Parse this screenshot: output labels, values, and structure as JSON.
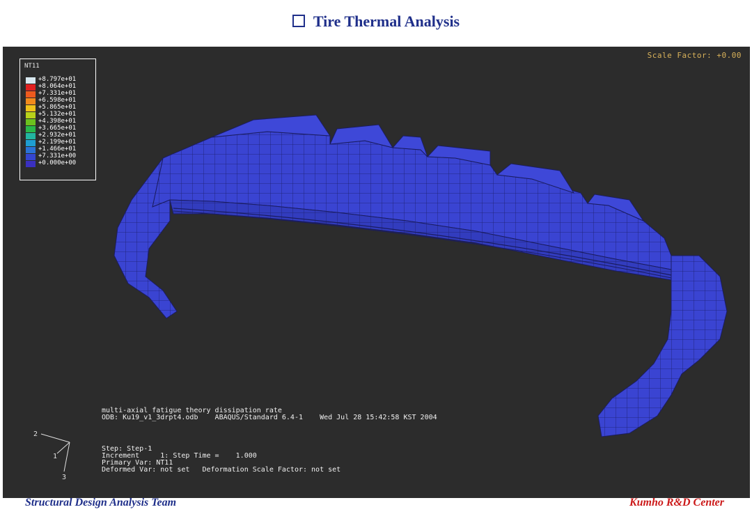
{
  "slide": {
    "title": "Tire Thermal Analysis",
    "footer_left": "Structural Design Analysis Team",
    "footer_right": "Kumho R&D Center"
  },
  "viewport": {
    "scale_factor": "Scale Factor: +0.00",
    "legend": {
      "variable": "NT11",
      "entries": [
        {
          "label": "+8.797e+01",
          "color": "#d8e8f0"
        },
        {
          "label": "+8.064e+01",
          "color": "#e02020"
        },
        {
          "label": "+7.331e+01",
          "color": "#ee5a1e"
        },
        {
          "label": "+6.598e+01",
          "color": "#f28a1c"
        },
        {
          "label": "+5.865e+01",
          "color": "#f0c21a"
        },
        {
          "label": "+5.132e+01",
          "color": "#b8d21a"
        },
        {
          "label": "+4.398e+01",
          "color": "#6cc21e"
        },
        {
          "label": "+3.665e+01",
          "color": "#2ab84a"
        },
        {
          "label": "+2.932e+01",
          "color": "#22b6a0"
        },
        {
          "label": "+2.199e+01",
          "color": "#1e9ed2"
        },
        {
          "label": "+1.466e+01",
          "color": "#2a72d6"
        },
        {
          "label": "+7.331e+00",
          "color": "#3446d0"
        },
        {
          "label": "+0.000e+00",
          "color": "#3a30c0"
        }
      ]
    },
    "annotation": {
      "line1": "multi-axial fatigue theory dissipation rate",
      "line2": "ODB: Ku19_v1_3drpt4.odb    ABAQUS/Standard 6.4-1    Wed Jul 28 15:42:58 KST 2004",
      "step": "Step: Step-1",
      "increment": "Increment     1: Step Time =    1.000",
      "primary_var": "Primary Var: NT11",
      "deformed_var": "Deformed Var: not set   Deformation Scale Factor: not set"
    },
    "triad": {
      "axis_1": "1",
      "axis_2": "2",
      "axis_3": "3"
    },
    "model_color": "#3a44d2"
  }
}
